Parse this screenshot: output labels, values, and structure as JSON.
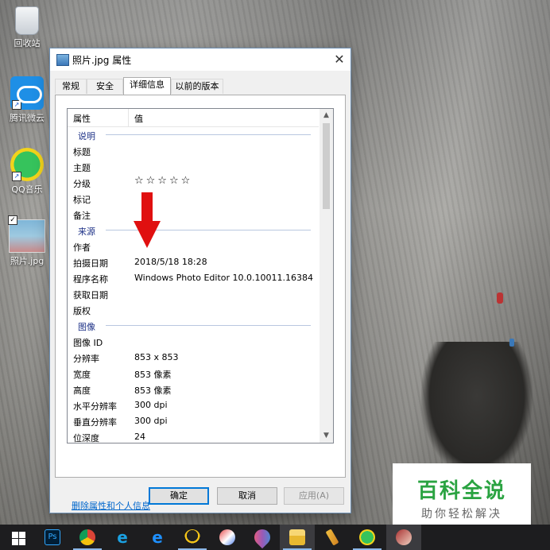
{
  "desktop": {
    "icons": [
      {
        "label": "回收站",
        "icon": "recycle-bin-icon"
      },
      {
        "label": "腾讯微云",
        "icon": "weiyun-cloud-icon"
      },
      {
        "label": "QQ音乐",
        "icon": "qq-music-icon"
      },
      {
        "label": "照片.jpg",
        "icon": "photo-file-icon"
      }
    ]
  },
  "dialog": {
    "title": "照片.jpg 属性",
    "close": "✕",
    "tabs": [
      "常规",
      "安全",
      "详细信息",
      "以前的版本"
    ],
    "active_tab": "详细信息",
    "list": {
      "header": {
        "col1": "属性",
        "col2": "值"
      },
      "rows": [
        {
          "type": "group",
          "label": "说明"
        },
        {
          "type": "item",
          "key": "标题",
          "value": ""
        },
        {
          "type": "item",
          "key": "主题",
          "value": ""
        },
        {
          "type": "item",
          "key": "分级",
          "value": "☆☆☆☆☆"
        },
        {
          "type": "item",
          "key": "标记",
          "value": ""
        },
        {
          "type": "item",
          "key": "备注",
          "value": ""
        },
        {
          "type": "group",
          "label": "来源"
        },
        {
          "type": "item",
          "key": "作者",
          "value": ""
        },
        {
          "type": "item",
          "key": "拍摄日期",
          "value": "2018/5/18 18:28"
        },
        {
          "type": "item",
          "key": "程序名称",
          "value": "Windows Photo Editor 10.0.10011.16384"
        },
        {
          "type": "item",
          "key": "获取日期",
          "value": ""
        },
        {
          "type": "item",
          "key": "版权",
          "value": ""
        },
        {
          "type": "group",
          "label": "图像"
        },
        {
          "type": "item",
          "key": "图像 ID",
          "value": ""
        },
        {
          "type": "item",
          "key": "分辨率",
          "value": "853 x 853"
        },
        {
          "type": "item",
          "key": "宽度",
          "value": "853 像素"
        },
        {
          "type": "item",
          "key": "高度",
          "value": "853 像素"
        },
        {
          "type": "item",
          "key": "水平分辨率",
          "value": "300 dpi"
        },
        {
          "type": "item",
          "key": "垂直分辨率",
          "value": "300 dpi"
        },
        {
          "type": "item",
          "key": "位深度",
          "value": "24"
        }
      ]
    },
    "remove_link": "删除属性和个人信息",
    "buttons": {
      "ok": "确定",
      "cancel": "取消",
      "apply": "应用(A)"
    }
  },
  "watermark": {
    "line1": "百科全说",
    "line2": "助你轻松解决"
  },
  "taskbar": {
    "apps": [
      "start-icon",
      "photoshop-icon",
      "chrome-icon",
      "ie-icon",
      "edge-icon",
      "qq-icon",
      "app-icon",
      "maps-icon",
      "file-explorer-icon",
      "cleaner-icon",
      "qq-music-icon",
      "media-icon"
    ],
    "ps_label": "Ps"
  },
  "colors": {
    "accent": "#0078d7",
    "arrow": "#e01010",
    "group_text": "#1e3287",
    "link": "#0066cc",
    "watermark_green": "#2aa341"
  }
}
